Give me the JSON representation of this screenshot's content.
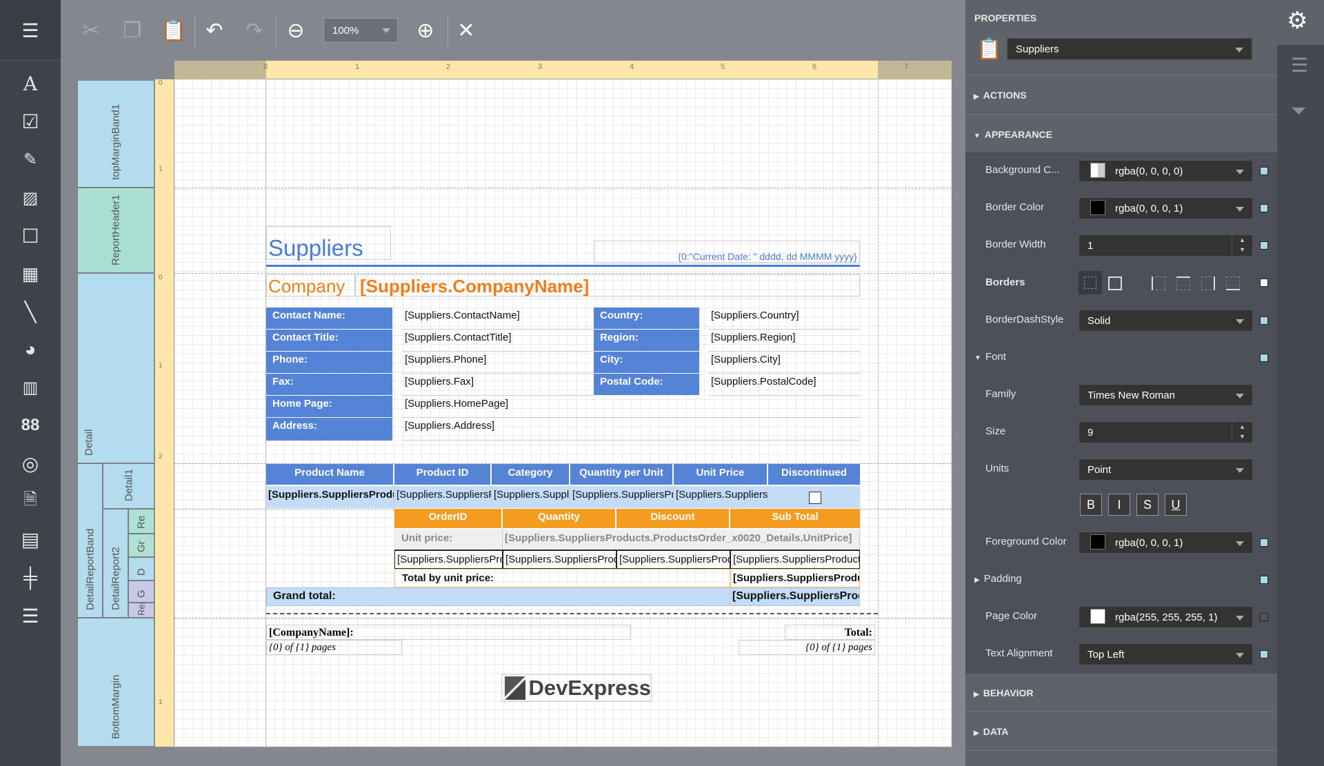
{
  "toolbar": {
    "zoom_value": "100%",
    "icons": [
      "menu-icon",
      "cut-icon",
      "copy-icon",
      "paste-icon",
      "undo-icon",
      "redo-icon",
      "zoom-out-icon",
      "zoom-in-icon",
      "close-icon"
    ]
  },
  "ruler": {
    "h_labels": [
      "0",
      "1",
      "2",
      "3",
      "4",
      "5",
      "6",
      "7"
    ]
  },
  "toolbox": [
    "label-icon",
    "checkbox-icon",
    "richtext-icon",
    "picture-icon",
    "panel-icon",
    "table-icon",
    "line-icon",
    "shape-icon",
    "barcode-icon",
    "zipcode-icon",
    "gauge-icon",
    "pageinfo-icon",
    "subreport-icon",
    "pagebreak-icon",
    "crossband-icon"
  ],
  "bands": {
    "topMargin": "topMarginBand1",
    "reportHeader": "ReportHeader1",
    "detail": "Detail",
    "detailReportBand": "DetailReportBand",
    "detail1": "Detail1",
    "detailReport2": "DetailReport2",
    "sub": [
      "Re",
      "Gr",
      "D",
      "G",
      "Repo"
    ],
    "bottomMargin": "BottomMargin"
  },
  "report": {
    "title": "Suppliers",
    "date_expr": "{0:\"Current Date: \" dddd, dd MMMM yyyy}",
    "company_label": "Company",
    "company_value": "[Suppliers.CompanyName]",
    "contact_left": [
      {
        "label": "Contact Name:",
        "value": "[Suppliers.ContactName]"
      },
      {
        "label": "Contact Title:",
        "value": "[Suppliers.ContactTitle]"
      },
      {
        "label": "Phone:",
        "value": "[Suppliers.Phone]"
      },
      {
        "label": "Fax:",
        "value": "[Suppliers.Fax]"
      },
      {
        "label": "Home Page:",
        "value": "[Suppliers.HomePage]"
      },
      {
        "label": "Address:",
        "value": "[Suppliers.Address]"
      }
    ],
    "contact_right": [
      {
        "label": "Country:",
        "value": "[Suppliers.Country]"
      },
      {
        "label": "Region:",
        "value": "[Suppliers.Region]"
      },
      {
        "label": "City:",
        "value": "[Suppliers.City]"
      },
      {
        "label": "Postal Code:",
        "value": "[Suppliers.PostalCode]"
      }
    ],
    "product_headers": [
      "Product Name",
      "Product ID",
      "Category",
      "Quantity per Unit",
      "Unit Price",
      "Discontinued"
    ],
    "product_cells": [
      "[Suppliers.SuppliersProductName]",
      "[Suppliers.SuppliersProducts.ProductID]",
      "[Suppliers.SuppliersProducts.Category]",
      "[Suppliers.SuppliersProducts.QuantityPerUnit]",
      "[Suppliers.SuppliersProducts.UnitPrice]"
    ],
    "order_headers": [
      "OrderID",
      "Quantity",
      "Discount",
      "Sub Total"
    ],
    "unit_price_label": "Unit price:",
    "unit_price_value": "[Suppliers.SuppliersProducts.ProductsOrder_x0020_Details.UnitPrice]",
    "order_cells": [
      "[Suppliers.SuppliersProducts.OrderID]",
      "[Suppliers.SuppliersProducts.Quantity]",
      "[Suppliers.SuppliersProducts.Discount]",
      "[Suppliers.SuppliersProducts.SubTotal]"
    ],
    "total_unit_label": "Total by unit price:",
    "total_unit_value": "[Suppliers.SuppliersProducts.Total]",
    "grand_total_label": "Grand total:",
    "grand_total_value": "[Suppliers.SuppliersProducts.GrandTotal]",
    "footer_company": "[CompanyName]:",
    "footer_pages": "{0} of {1} pages",
    "footer_total": "Total:",
    "footer_pages_right": "{0} of {1} pages",
    "logo_text": "DevExpress"
  },
  "properties": {
    "title": "PROPERTIES",
    "selected": "Suppliers",
    "sections": {
      "actions": "ACTIONS",
      "appearance": "APPEARANCE",
      "behavior": "BEHAVIOR",
      "data": "DATA"
    },
    "background_color": {
      "label": "Background C...",
      "value": "rgba(0, 0, 0, 0)"
    },
    "border_color": {
      "label": "Border Color",
      "value": "rgba(0, 0, 0, 1)"
    },
    "border_width": {
      "label": "Border Width",
      "value": "1"
    },
    "borders": {
      "label": "Borders"
    },
    "border_dash": {
      "label": "BorderDashStyle",
      "value": "Solid"
    },
    "font": {
      "label": "Font",
      "family_label": "Family",
      "family": "Times New Roman",
      "size_label": "Size",
      "size": "9",
      "units_label": "Units",
      "units": "Point",
      "styles": [
        "B",
        "I",
        "S",
        "U"
      ]
    },
    "foreground": {
      "label": "Foreground Color",
      "value": "rgba(0, 0, 0, 1)"
    },
    "padding": {
      "label": "Padding"
    },
    "page_color": {
      "label": "Page Color",
      "value": "rgba(255, 255, 255, 1)"
    },
    "text_alignment": {
      "label": "Text Alignment",
      "value": "Top Left"
    }
  },
  "colors": {
    "accent_blue": "#5584d6",
    "accent_orange": "#f39c1f",
    "light_blue": "#c3dcf8"
  }
}
